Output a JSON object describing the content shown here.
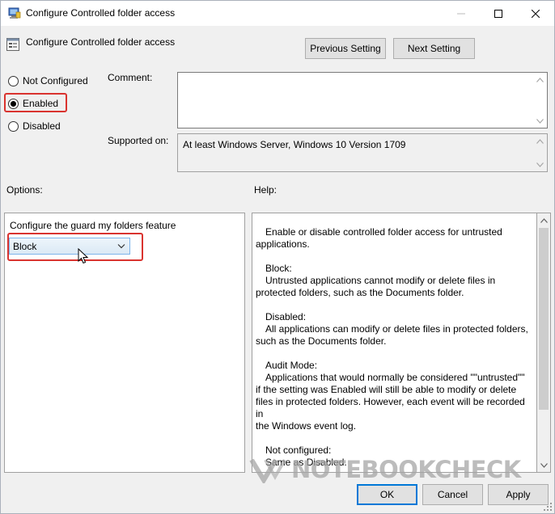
{
  "window": {
    "title": "Configure Controlled folder access"
  },
  "header": {
    "policy_title": "Configure Controlled folder access",
    "previous_label": "Previous Setting",
    "next_label": "Next Setting"
  },
  "state": {
    "options": [
      "Not Configured",
      "Enabled",
      "Disabled"
    ],
    "selected": "Enabled"
  },
  "labels": {
    "comment": "Comment:",
    "supported_on": "Supported on:",
    "options": "Options:",
    "help": "Help:"
  },
  "comment_value": "",
  "supported_value": "At least Windows Server, Windows 10 Version 1709",
  "options_panel": {
    "feature_label": "Configure the guard my folders feature",
    "combo_value": "Block"
  },
  "help": {
    "paragraphs": [
      [
        "Enable or disable controlled folder access for untrusted",
        "applications."
      ],
      [
        "Block:",
        "Untrusted applications cannot modify or delete files in",
        "protected folders, such as the Documents folder."
      ],
      [
        "Disabled:",
        "All applications can modify or delete files in protected folders,",
        "such as the Documents folder."
      ],
      [
        "Audit Mode:",
        "Applications that would normally be considered \"\"untrusted\"\"",
        "if the setting was Enabled will still be able to modify or delete",
        "files in protected folders. However, each event will be recorded in",
        "the Windows event log."
      ],
      [
        "Not configured:",
        "Same as Disabled."
      ]
    ]
  },
  "footer": {
    "ok_label": "OK",
    "cancel_label": "Cancel",
    "apply_label": "Apply"
  },
  "watermark": {
    "text": "NOTEBOOKCHECK"
  },
  "icons": {
    "app": "group-policy-icon",
    "policy": "policy-setting-icon",
    "minimize": "minimize-icon",
    "maximize": "maximize-icon",
    "close": "close-icon",
    "dropdown": "chevron-down-icon",
    "cursor": "mouse-cursor-icon"
  },
  "colors": {
    "highlight": "#d9332f",
    "accent": "#0078d7",
    "combo_border": "#7eb4ea"
  }
}
